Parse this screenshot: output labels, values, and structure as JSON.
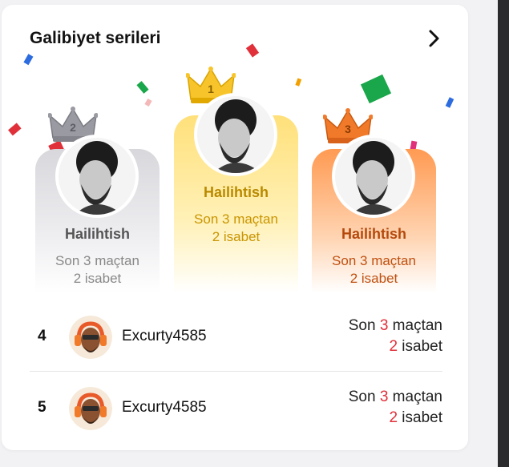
{
  "card": {
    "title": "Galibiyet serileri"
  },
  "podium": [
    {
      "rank": "2",
      "name": "Hailihtish",
      "line1": "Son 3 maçtan",
      "line2": "2 isabet"
    },
    {
      "rank": "1",
      "name": "Hailihtish",
      "line1": "Son 3 maçtan",
      "line2": "2 isabet"
    },
    {
      "rank": "3",
      "name": "Hailihtish",
      "line1": "Son 3 maçtan",
      "line2": "2 isabet"
    }
  ],
  "list": [
    {
      "rank": "4",
      "name": "Excurty4585",
      "prefix": "Son ",
      "matches": "3",
      "suffix": " maçtan",
      "hits": "2",
      "hits_label": " isabet"
    },
    {
      "rank": "5",
      "name": "Excurty4585",
      "prefix": "Son ",
      "matches": "3",
      "suffix": " maçtan",
      "hits": "2",
      "hits_label": " isabet"
    }
  ],
  "colors": {
    "silver_text": "#555555",
    "silver_sub": "#888888",
    "gold_text": "#b88a00",
    "gold_sub": "#c99500",
    "bronze_text": "#b4490c",
    "bronze_sub": "#c05010",
    "accent_red": "#e0303a"
  },
  "icons": {
    "chevron": "chevron-right-icon",
    "crown": "crown-icon"
  }
}
